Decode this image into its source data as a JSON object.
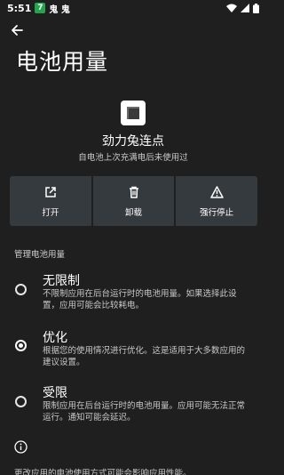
{
  "status_bar": {
    "time": "5:51",
    "notification_app_glyph": "7",
    "notification_text": "鬼 鬼",
    "icons": [
      "wifi-icon",
      "signal-icon",
      "battery-icon"
    ]
  },
  "toolbar": {
    "back_icon": "arrow-left-icon"
  },
  "page": {
    "title": "电池用量"
  },
  "app": {
    "name": "劲力兔连点",
    "subtitle": "自电池上次充满电后未使用过",
    "icon": "app-icon"
  },
  "actions": [
    {
      "label": "打开",
      "icon": "open-external-icon"
    },
    {
      "label": "卸载",
      "icon": "trash-icon"
    },
    {
      "label": "强行停止",
      "icon": "warning-icon"
    }
  ],
  "section": {
    "header": "管理电池用量"
  },
  "options": [
    {
      "title": "无限制",
      "desc": "不限制应用在后台运行时的电池用量。如果选择此设置，应用可能会比较耗电。",
      "checked": false
    },
    {
      "title": "优化",
      "desc": "根据您的使用情况进行优化。这是适用于大多数应用的建议设置。",
      "checked": true
    },
    {
      "title": "受限",
      "desc": "限制应用在后台运行时的电池用量。应用可能无法正常运行。通知可能会延迟。",
      "checked": false
    }
  ],
  "footer": {
    "info_icon": "info-icon",
    "text": "更改应用的电池使用方式可能会影响应用性能。"
  },
  "colors": {
    "background": "#1f1f1f",
    "action_button_bg": "#353a3f",
    "text_primary": "#ffffff",
    "text_secondary": "#c8c8c8"
  }
}
